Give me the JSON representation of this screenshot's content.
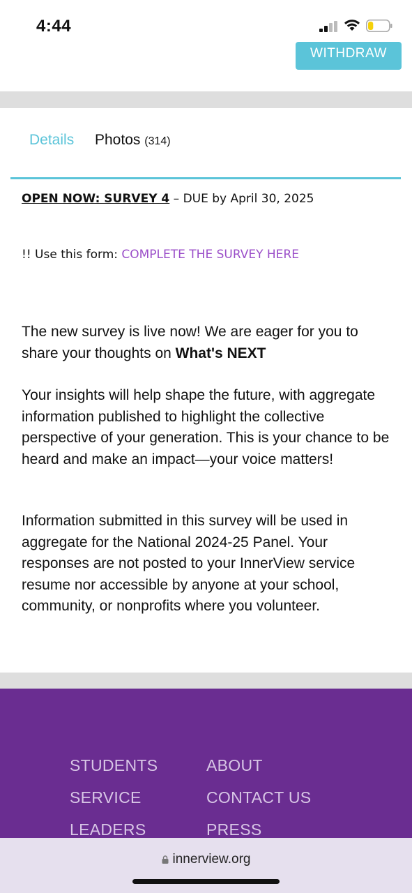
{
  "status_bar": {
    "time": "4:44",
    "signal_icon": "cellular-signal-icon",
    "wifi_icon": "wifi-icon",
    "battery_icon": "battery-low-icon",
    "battery_level": 0.25,
    "battery_color": "#f5d10a"
  },
  "header": {
    "withdraw_label": "WITHDRAW",
    "accent_color": "#5bc4d9"
  },
  "tabs": [
    {
      "label": "Details",
      "count": ""
    },
    {
      "label": "Photos",
      "count": "(314)"
    }
  ],
  "content": {
    "survey_heading": "OPEN NOW: SURVEY 4",
    "survey_due": " – DUE by April 30, 2025",
    "form_prefix": "!! Use this form: ",
    "form_link": "COMPLETE THE SURVEY HERE",
    "para1_text": "The new survey is live now! We are eager for you to share your thoughts on ",
    "para1_bold": "What's NEXT",
    "para2": "Your insights will help shape the future, with aggregate information published to highlight the collective perspective of your generation. This is your chance to be heard and make an impact—your voice matters!",
    "para3": "Information submitted in this survey will be used in aggregate for the National 2024-25 Panel.  Your responses are not posted to your InnerView service resume nor accessible by anyone at your school, community, or nonprofits where you volunteer."
  },
  "footer": {
    "links": [
      "STUDENTS",
      "SERVICE",
      "LEADERS",
      "ABOUT",
      "CONTACT US",
      "PRESS"
    ],
    "background_color": "#6a2d91"
  },
  "browser": {
    "url": "innerview.org",
    "lock_icon": "lock-icon"
  }
}
